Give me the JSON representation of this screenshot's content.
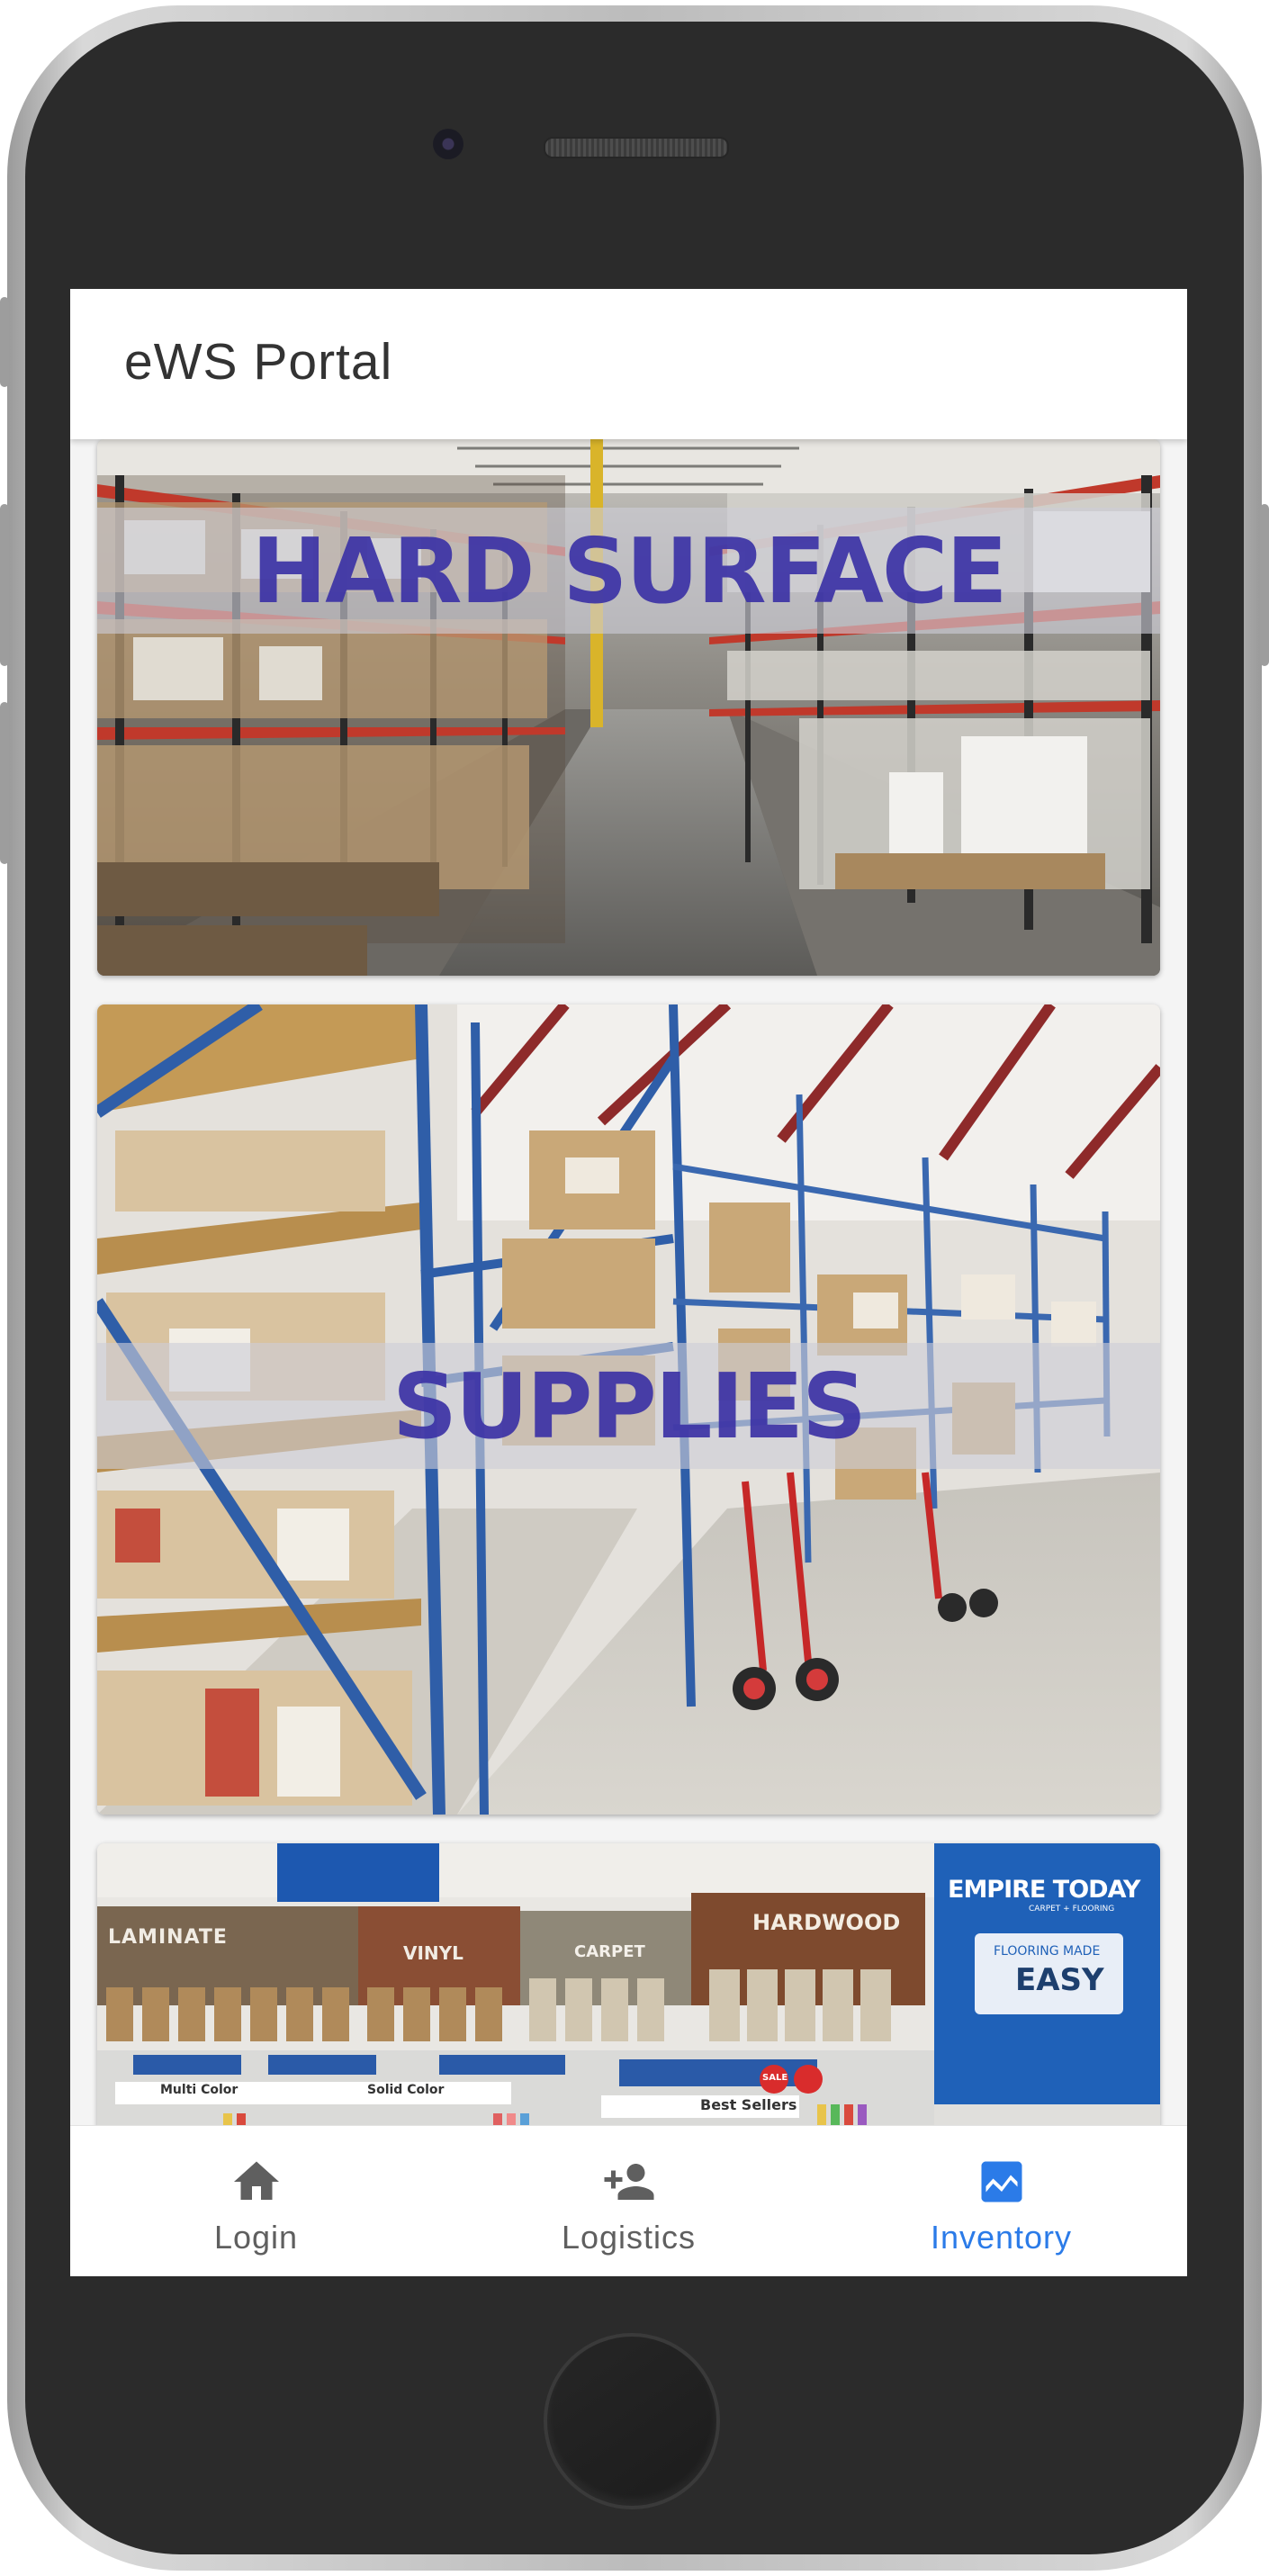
{
  "app": {
    "title": "eWS Portal"
  },
  "cards": [
    {
      "label": "HARD SURFACE",
      "photo": "warehouse-aisle-photo"
    },
    {
      "label": "SUPPLIES",
      "photo": "supply-shelves-photo"
    },
    {
      "label": "",
      "photo": "showroom-photo"
    }
  ],
  "showroom_signs": {
    "laminate": "LAMINATE",
    "vinyl": "VINYL",
    "carpet": "CARPET",
    "hardwood": "HARDWOOD",
    "brand": "EMPIRE TODAY",
    "brand_sub": "CARPET + FLOORING",
    "tagline_small": "FLOORING MADE",
    "tagline_big": "EASY",
    "multi_color": "Multi Color",
    "solid_color": "Solid Color",
    "best_sellers": "Best Sellers",
    "sale": "SALE"
  },
  "nav": {
    "items": [
      {
        "label": "Login",
        "icon": "home-icon",
        "active": false
      },
      {
        "label": "Logistics",
        "icon": "person-add-icon",
        "active": false
      },
      {
        "label": "Inventory",
        "icon": "chart-icon",
        "active": true
      }
    ]
  },
  "colors": {
    "accent": "#2b7be8",
    "label_text": "#3c33a6",
    "inactive_nav": "#5f5f5f"
  }
}
